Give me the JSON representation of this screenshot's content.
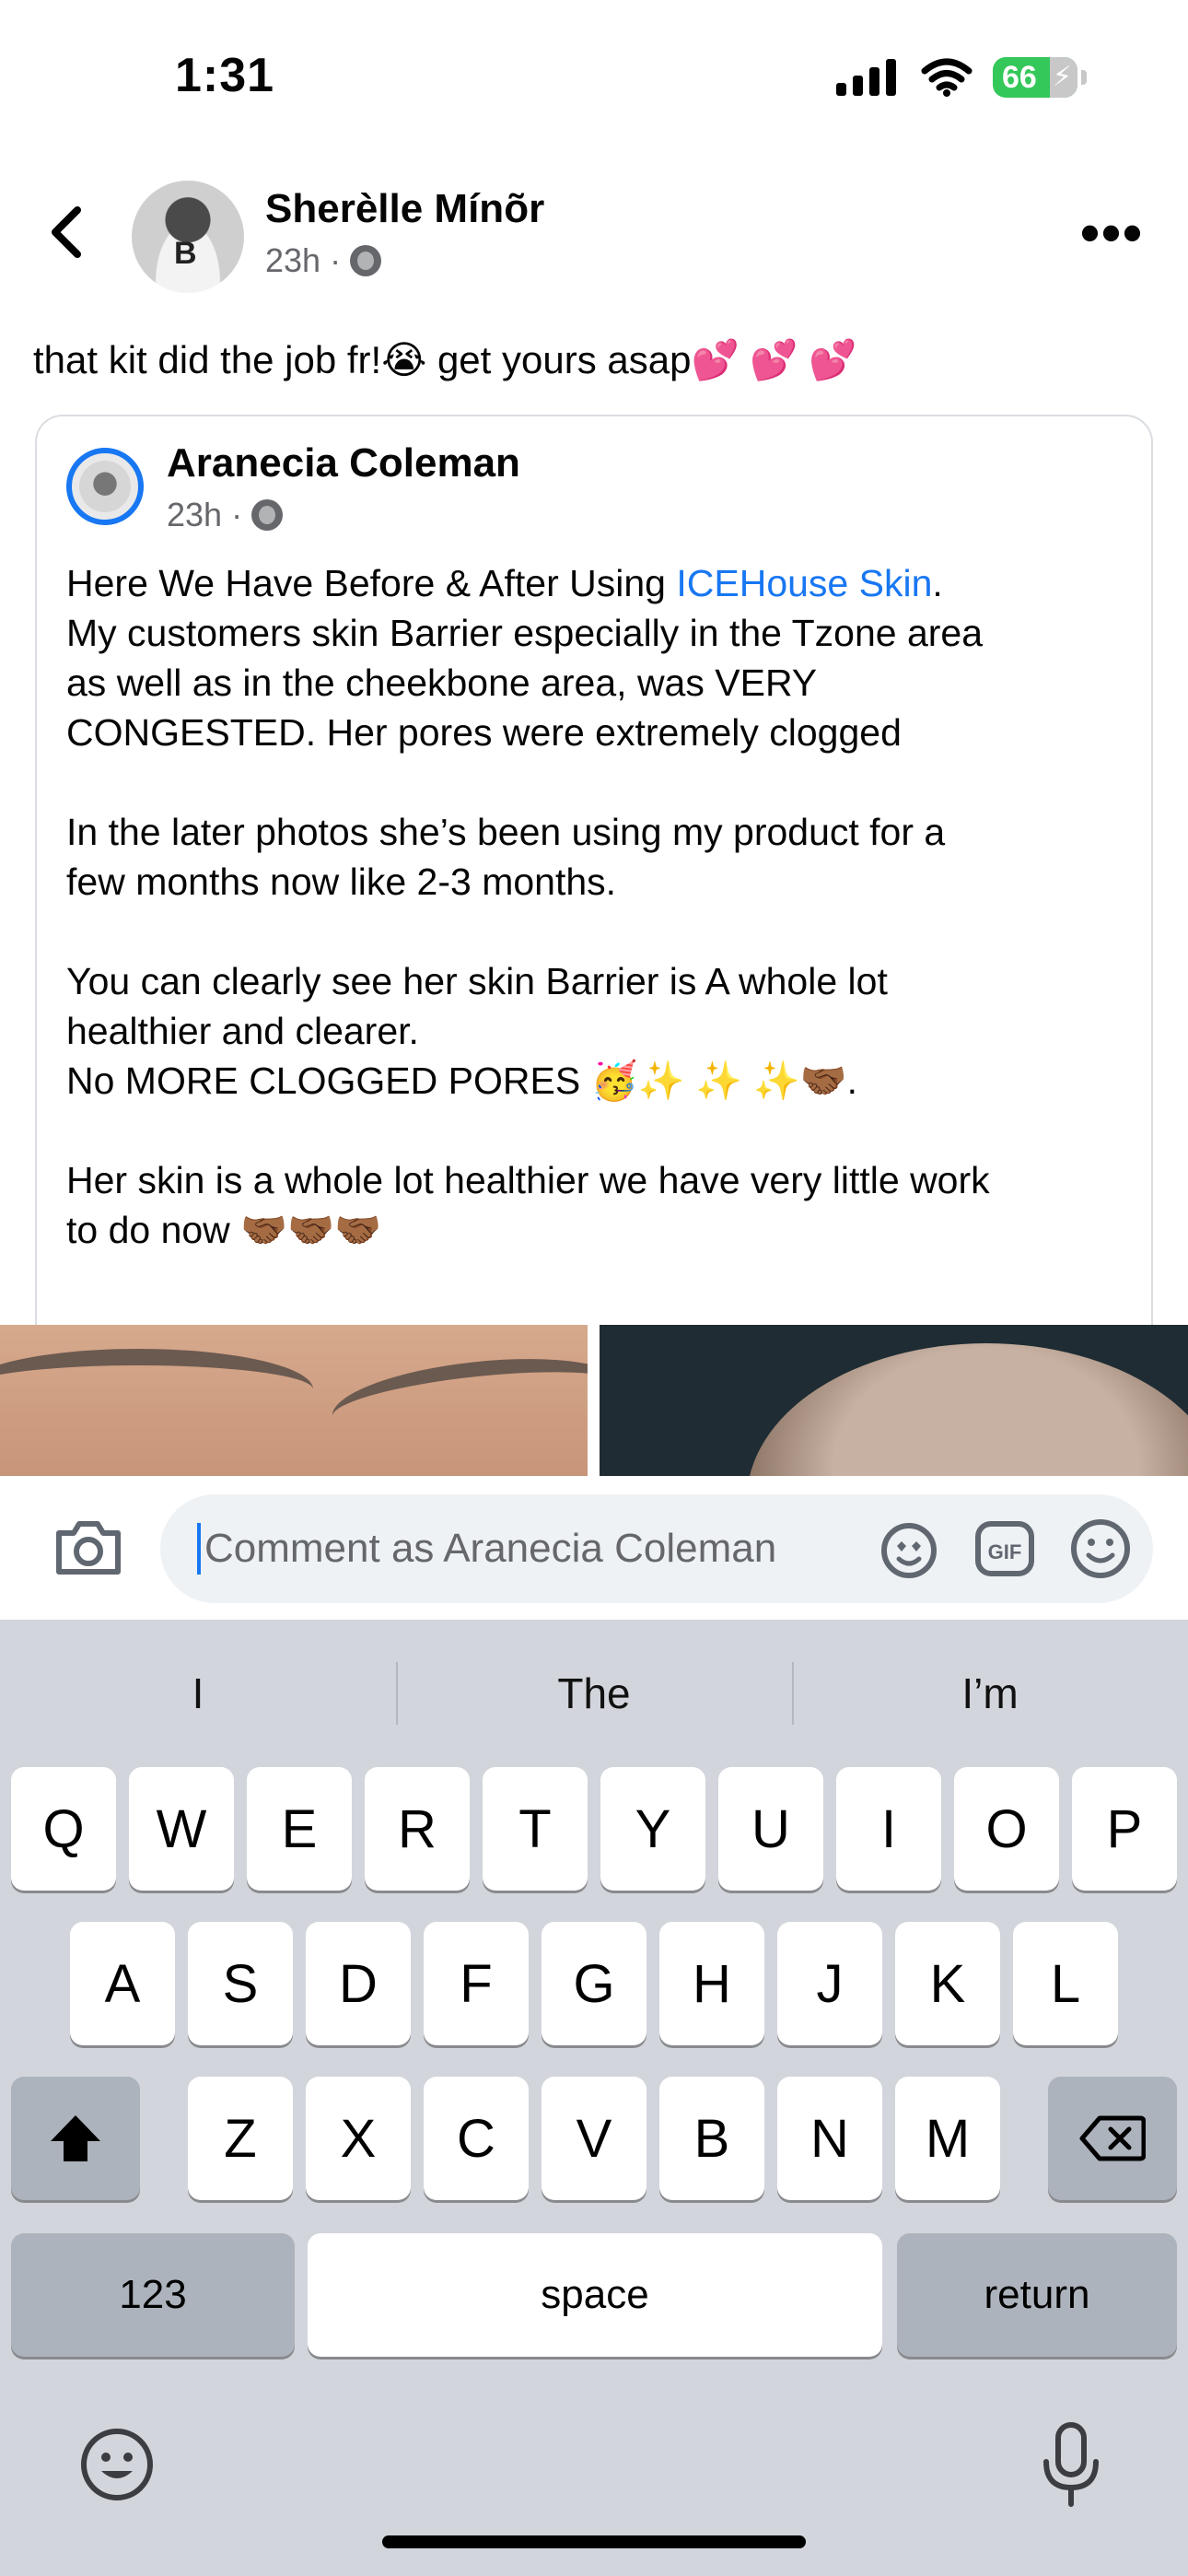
{
  "status": {
    "time": "1:31",
    "battery": "66"
  },
  "post": {
    "author": "Sherèlle Mínõr",
    "time": "23h",
    "caption": "that kit did the job fr!😭 get yours asap💕 💕 💕"
  },
  "shared": {
    "author": "Aranecia Coleman",
    "time": "23h",
    "line1_before": "Here We Have Before & After Using ",
    "link": "ICEHouse Skin",
    "line1_after": ".",
    "body": "\nMy customers skin Barrier especially in the Tzone area\nas well as in the cheekbone area, was VERY\nCONGESTED. Her pores were extremely clogged\n\nIn the later photos she’s been using my product for a\nfew months now like 2-3 months.\n\nYou can clearly see her skin Barrier is A whole lot\nhealthier and clearer.\nNo MORE CLOGGED PORES 🥳✨ ✨ ✨🤝🏾.\n\nHer skin is a whole lot healthier we have very little work\nto do now 🤝🏾🤝🏾🤝🏾"
  },
  "comment": {
    "placeholder": "Comment as Aranecia Coleman"
  },
  "keyboard": {
    "suggestions": [
      "I",
      "The",
      "I’m"
    ],
    "row1": [
      "Q",
      "W",
      "E",
      "R",
      "T",
      "Y",
      "U",
      "I",
      "O",
      "P"
    ],
    "row2": [
      "A",
      "S",
      "D",
      "F",
      "G",
      "H",
      "J",
      "K",
      "L"
    ],
    "row3": [
      "Z",
      "X",
      "C",
      "V",
      "B",
      "N",
      "M"
    ],
    "numbers": "123",
    "space": "space",
    "return": "return"
  },
  "icons": [
    "back-icon",
    "globe-icon",
    "more-icon",
    "camera-icon",
    "avatar-sticker-icon",
    "gif-icon",
    "emoji-icon",
    "shift-icon",
    "delete-icon",
    "keyboard-emoji-icon",
    "microphone-icon"
  ]
}
